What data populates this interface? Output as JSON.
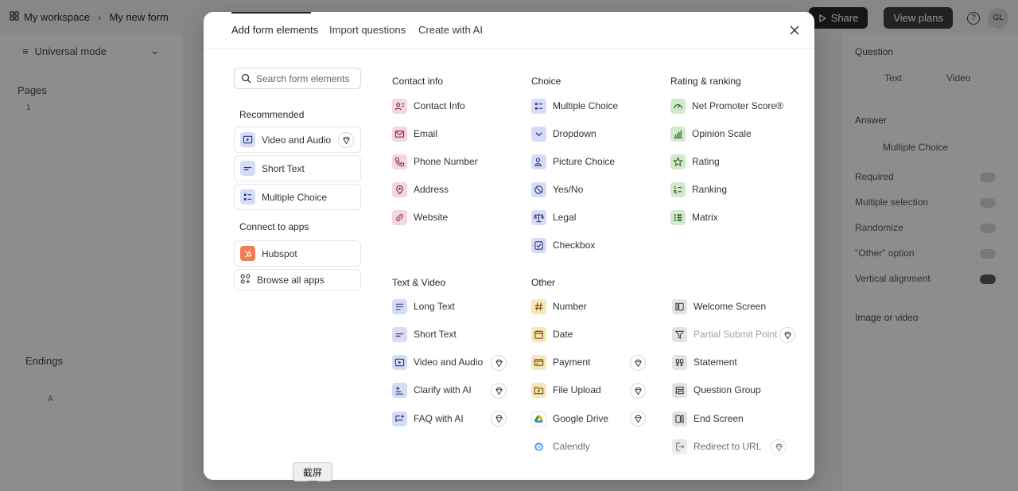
{
  "app": {
    "workspace": "My workspace",
    "form_name": "My new form",
    "share_label": "Share",
    "view_plans_label": "View plans",
    "avatar_initials": "GL",
    "mode_label": "Universal mode",
    "pages_title": "Pages",
    "page_number": "1",
    "endings_title": "Endings",
    "ending_badge": "A",
    "right_panel": {
      "question_title": "Question",
      "text_tab": "Text",
      "video_tab": "Video",
      "answer_title": "Answer",
      "answer_type": "Multiple Choice",
      "required": "Required",
      "multiple_selection": "Multiple selection",
      "randomize": "Randomize",
      "other_option": "\"Other\" option",
      "vertical_alignment": "Vertical alignment",
      "image_or_video": "Image or video"
    }
  },
  "modal": {
    "tabs": [
      "Add form elements",
      "Import questions",
      "Create with AI"
    ],
    "search_placeholder": "Search form elements",
    "recommended_title": "Recommended",
    "recommended": [
      "Video and Audio",
      "Short Text",
      "Multiple Choice"
    ],
    "connect_title": "Connect to apps",
    "hubspot": "Hubspot",
    "browse_apps": "Browse all apps",
    "contact_title": "Contact info",
    "contact": [
      "Contact Info",
      "Email",
      "Phone Number",
      "Address",
      "Website"
    ],
    "choice_title": "Choice",
    "choice": [
      "Multiple Choice",
      "Dropdown",
      "Picture Choice",
      "Yes/No",
      "Legal",
      "Checkbox"
    ],
    "rating_title": "Rating & ranking",
    "rating": [
      "Net Promoter Score®",
      "Opinion Scale",
      "Rating",
      "Ranking",
      "Matrix"
    ],
    "textvideo_title": "Text & Video",
    "textvideo": [
      "Long Text",
      "Short Text",
      "Video and Audio",
      "Clarify with AI",
      "FAQ with AI"
    ],
    "other_title": "Other",
    "other": [
      "Number",
      "Date",
      "Payment",
      "File Upload",
      "Google Drive",
      "Calendly"
    ],
    "other2": [
      "Welcome Screen",
      "Partial Submit Point",
      "Statement",
      "Question Group",
      "End Screen",
      "Redirect to URL"
    ]
  },
  "tooltip": "截屏"
}
